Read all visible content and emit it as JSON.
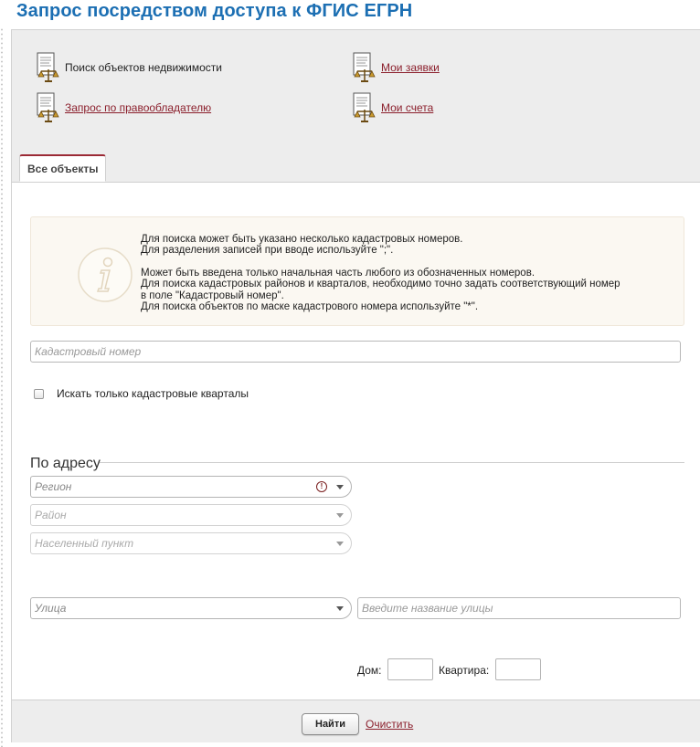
{
  "page": {
    "title": "Запрос посредством доступа к ФГИС ЕГРН"
  },
  "nav": [
    {
      "label": "Поиск объектов недвижимости",
      "link": false
    },
    {
      "label": "Мои заявки",
      "link": true
    },
    {
      "label": "Запрос по правообладателю",
      "link": true
    },
    {
      "label": "Мои счета",
      "link": true
    }
  ],
  "tabs": [
    {
      "label": "Все объекты",
      "active": true
    }
  ],
  "info": {
    "icon": "info-i-icon",
    "lines": [
      "Для поиска может быть указано несколько кадастровых номеров.",
      "Для разделения записей при вводе используйте \";\".",
      "Может быть введена только начальная часть любого из обозначенных номеров.",
      "Для поиска кадастровых районов и кварталов, необходимо точно задать соответствующий номер",
      "в поле \"Кадастровый номер\".",
      "Для поиска объектов по маске кадастрового номера используйте \"*\"."
    ]
  },
  "cadastral": {
    "placeholder": "Кадастровый номер",
    "value": ""
  },
  "checkbox": {
    "label": "Искать только кадастровые кварталы",
    "checked": false
  },
  "address": {
    "title": "По адресу",
    "region": {
      "placeholder": "Регион",
      "alert": "!"
    },
    "district": {
      "placeholder": "Район"
    },
    "locality": {
      "placeholder": "Населенный пункт"
    },
    "street_type": {
      "placeholder": "Улица"
    },
    "street_name": {
      "placeholder": "Введите название улицы"
    },
    "house_label": "Дом:",
    "flat_label": "Квартира:"
  },
  "footer": {
    "find_label": "Найти",
    "clear_label": "Очистить"
  },
  "colors": {
    "title": "#1c6fb3",
    "link": "#8b1f2c",
    "tab_accent": "#9b2a35",
    "panel_bg": "#ededed"
  }
}
